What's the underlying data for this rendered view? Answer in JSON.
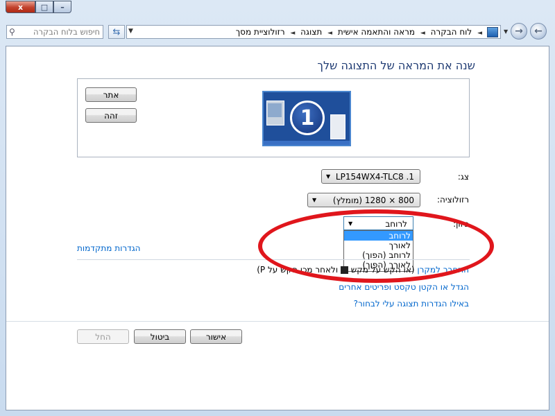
{
  "window": {
    "caption_close": "x",
    "caption_max": "□",
    "caption_min": "–"
  },
  "search": {
    "placeholder": "חיפוש בלוח הבקרה"
  },
  "address": {
    "crumbs": [
      "לוח הבקרה",
      "מראה והתאמה אישית",
      "תצוגה",
      "רזולוציית מסך"
    ],
    "separator": "◄"
  },
  "page": {
    "title": "שנה את המראה של התצוגה שלך",
    "detect_label": "אתר",
    "identify_label": "זהה",
    "monitor_number": "1"
  },
  "fields": {
    "display": {
      "label": "צג:",
      "value": "LP154WX4-TLC8 .1"
    },
    "resolution": {
      "label": "רזולוציה:",
      "value": "800 × 1280 (מומלץ)"
    },
    "orientation": {
      "label": "כיוון:",
      "value": "לרוחב",
      "options": [
        "לרוחב",
        "לאורך",
        "לרוחב (הפוך)",
        "לאורך (הפוך)"
      ],
      "selected_index": 0
    }
  },
  "links": {
    "advanced": "הגדרות מתקדמות",
    "projector_prefix": "התחבר למקרן",
    "projector_rest": "(או הקש על מקש",
    "projector_tail": "ולאחר מכן הקש על P)",
    "text_size": "הגדל או הקטן טקסט ופריטים אחרים",
    "which_settings": "באילו הגדרות תצוגה עלי לבחור?"
  },
  "buttons": {
    "ok": "אישור",
    "cancel": "ביטול",
    "apply": "החל"
  },
  "colors": {
    "title_text": "#1e3a72",
    "link": "#0066cc",
    "selection": "#3399ff",
    "annotation": "#e0161c"
  }
}
